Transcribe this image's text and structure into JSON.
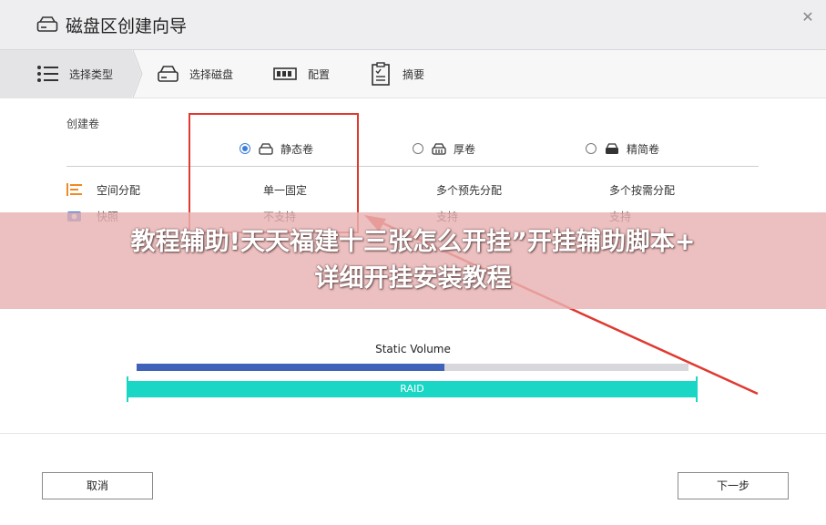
{
  "window": {
    "title": "磁盘区创建向导"
  },
  "steps": [
    {
      "label": "选择类型",
      "icon": "list-icon",
      "active": true
    },
    {
      "label": "选择磁盘",
      "icon": "disk-icon",
      "active": false
    },
    {
      "label": "配置",
      "icon": "config-icon",
      "active": false
    },
    {
      "label": "摘要",
      "icon": "clipboard-icon",
      "active": false
    }
  ],
  "create": {
    "label": "创建卷",
    "options": [
      {
        "label": "静态卷",
        "selected": true
      },
      {
        "label": "厚卷",
        "selected": false
      },
      {
        "label": "精简卷",
        "selected": false
      }
    ]
  },
  "features": [
    {
      "label": "空间分配",
      "icon": "allocation-icon",
      "values": [
        "单一固定",
        "多个预先分配",
        "多个按需分配"
      ]
    },
    {
      "label": "快照",
      "icon": "snapshot-icon",
      "values": [
        "不支持",
        "支持",
        "支持"
      ]
    }
  ],
  "volume": {
    "title": "Static Volume",
    "fill_fraction": 0.557,
    "raid_label": "RAID"
  },
  "buttons": {
    "cancel": "取消",
    "next": "下一步"
  },
  "overlay": {
    "banner_line1": "教程辅助!天天福建十三张怎么开挂”开挂辅助脚本+",
    "banner_line2": "详细开挂安装教程"
  },
  "colors": {
    "accent": "#3b7dd8",
    "bar_fill": "#3f63b8",
    "raid": "#1ad6c4",
    "annotation": "#e0392f"
  }
}
